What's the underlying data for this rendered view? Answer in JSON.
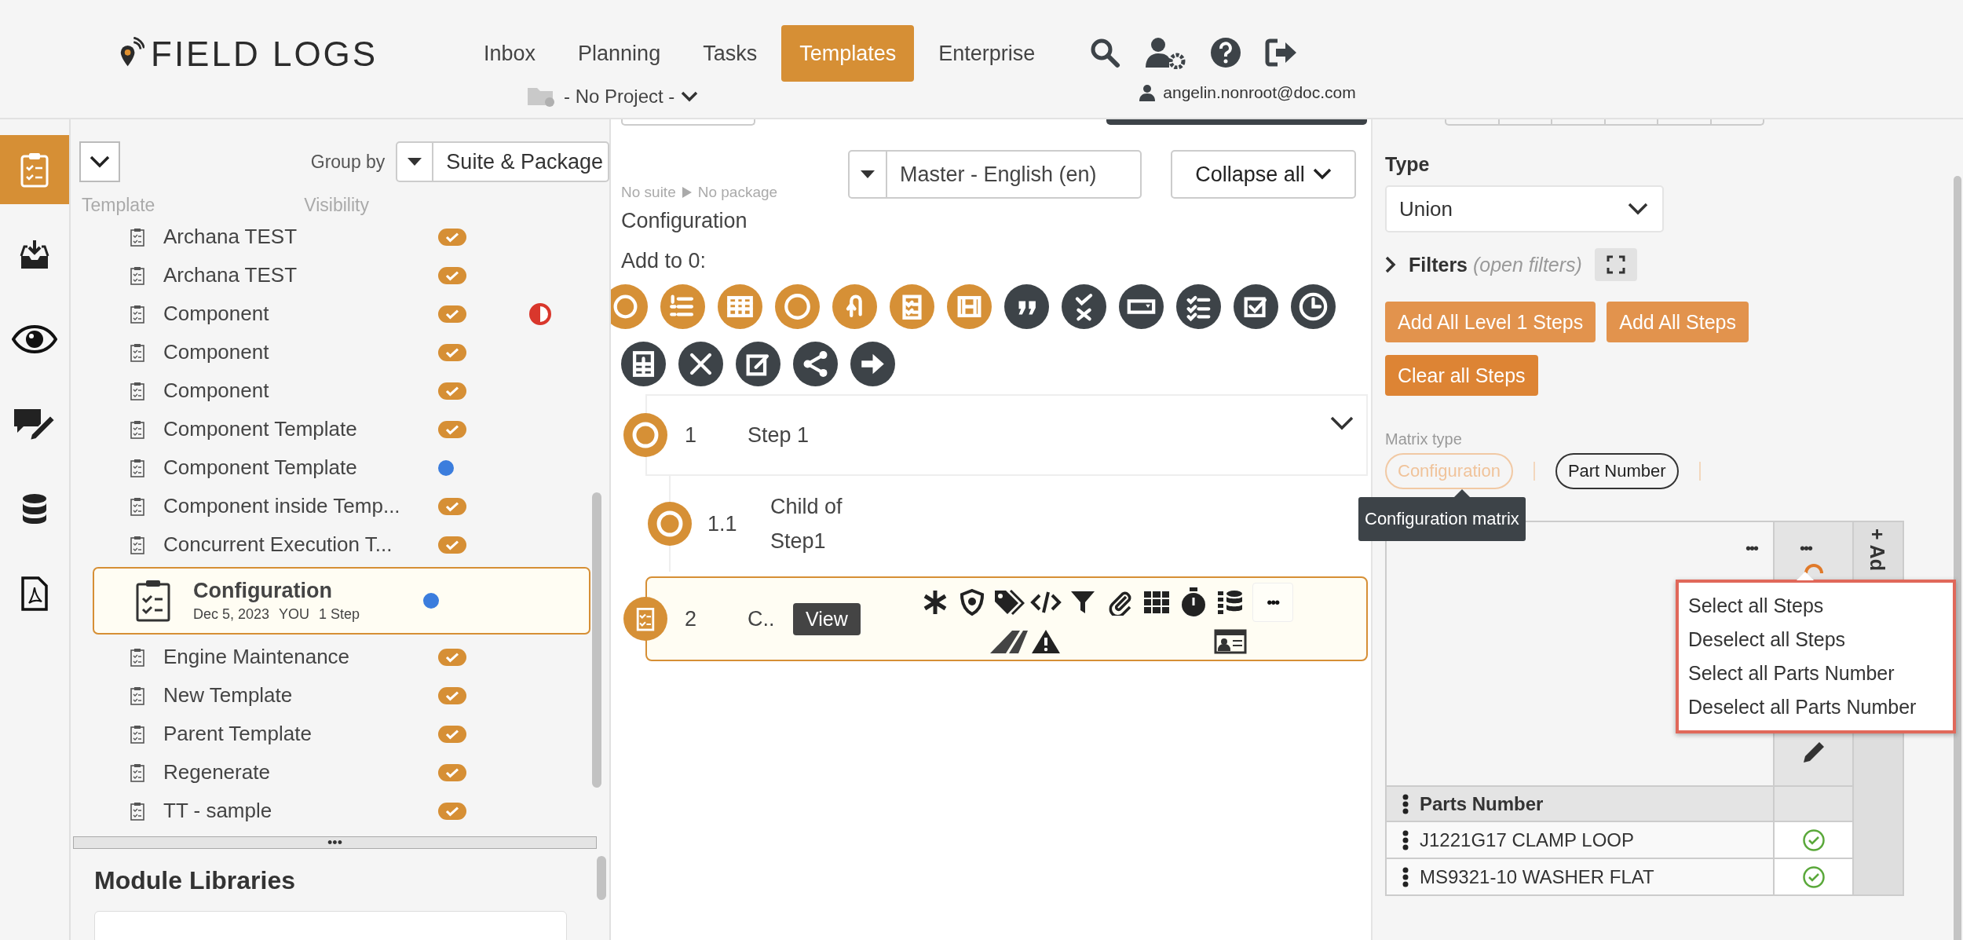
{
  "header": {
    "logo": "FIELD LOGS",
    "nav": [
      {
        "label": "Inbox",
        "selected": false
      },
      {
        "label": "Planning",
        "selected": false
      },
      {
        "label": "Tasks",
        "selected": false
      },
      {
        "label": "Templates",
        "selected": true
      },
      {
        "label": "Enterprise",
        "selected": false
      }
    ],
    "project": "- No Project -",
    "user": "angelin.nonroot@doc.com"
  },
  "rail": [
    {
      "selected": true
    },
    {
      "selected": false
    },
    {
      "selected": false
    },
    {
      "selected": false
    },
    {
      "selected": false
    },
    {
      "selected": false
    }
  ],
  "templates": {
    "group_by_label": "Group by",
    "group_by": "Suite & Package",
    "columns": [
      "Template",
      "Visibility"
    ],
    "items": [
      {
        "name": "Archana TEST",
        "visible": true,
        "flagged": false,
        "selected": false
      },
      {
        "name": "Archana TEST",
        "visible": true,
        "flagged": false,
        "selected": false
      },
      {
        "name": "Component",
        "visible": true,
        "flagged": true,
        "selected": false
      },
      {
        "name": "Component",
        "visible": true,
        "flagged": false,
        "selected": false
      },
      {
        "name": "Component",
        "visible": true,
        "flagged": false,
        "selected": false
      },
      {
        "name": "Component Template",
        "visible": true,
        "flagged": false,
        "selected": false
      },
      {
        "name": "Component Template",
        "visible": false,
        "flagged": false,
        "selected": false
      },
      {
        "name": "Component inside Temp...",
        "visible": true,
        "flagged": false,
        "selected": false
      },
      {
        "name": "Concurrent Execution T...",
        "visible": true,
        "flagged": false,
        "selected": false
      },
      {
        "name": "Configuration",
        "visible": false,
        "flagged": false,
        "selected": true,
        "date": "Dec 5, 2023",
        "author": "YOU",
        "steps": "1 Step"
      },
      {
        "name": "Engine Maintenance",
        "visible": true,
        "flagged": false,
        "selected": false
      },
      {
        "name": "New Template",
        "visible": true,
        "flagged": false,
        "selected": false
      },
      {
        "name": "Parent Template",
        "visible": true,
        "flagged": false,
        "selected": false
      },
      {
        "name": "Regenerate",
        "visible": true,
        "flagged": false,
        "selected": false
      },
      {
        "name": "TT - sample",
        "visible": true,
        "flagged": false,
        "selected": false
      }
    ],
    "more": "•••"
  },
  "module_libraries": {
    "title": "Module Libraries"
  },
  "editor": {
    "breadcrumb": [
      "No suite",
      "No package"
    ],
    "title": "Configuration",
    "language": "Master - English (en)",
    "collapse": "Collapse all",
    "add_label": "Add to 0:",
    "step_types": [
      {
        "color": "#d69036"
      },
      {
        "color": "#d69036"
      },
      {
        "color": "#d69036"
      },
      {
        "color": "#d69036"
      },
      {
        "color": "#d69036"
      },
      {
        "color": "#d69036"
      },
      {
        "color": "#d69036"
      },
      {
        "color": "#3d4348"
      },
      {
        "color": "#3d4348"
      },
      {
        "color": "#3d4348"
      },
      {
        "color": "#3d4348"
      },
      {
        "color": "#3d4348"
      },
      {
        "color": "#3d4348"
      },
      {
        "color": "#3d4348"
      },
      {
        "color": "#3d4348"
      },
      {
        "color": "#3d4348"
      },
      {
        "color": "#3d4348"
      },
      {
        "color": "#3d4348"
      }
    ],
    "steps": [
      {
        "kind": "circle",
        "number": "1",
        "title": "Step 1",
        "expanded": true,
        "selected": false,
        "children": [
          {
            "kind": "circle",
            "number": "1.1",
            "title": "Child of Step1",
            "selected": false
          }
        ]
      },
      {
        "kind": "checklist",
        "number": "2",
        "title": "C..",
        "selected": true,
        "action": "View",
        "more": "•••"
      }
    ]
  },
  "matrix": {
    "type_label": "Type",
    "type": "Union",
    "filters_label": "Filters",
    "filters_hint": "(open filters)",
    "buttons": [
      {
        "label": "Add All Level 1 Steps",
        "kind": "add"
      },
      {
        "label": "Add All Steps",
        "kind": "add"
      },
      {
        "label": "Clear all Steps",
        "kind": "clear"
      }
    ],
    "matrix_type_label": "Matrix type",
    "matrix_types": [
      {
        "label": "Configuration",
        "selected": true
      },
      {
        "label": "Part Number",
        "selected": false
      }
    ],
    "tooltip": "Configuration matrix",
    "row_more": "•••",
    "column_more": "•••",
    "add_column": "+ Ad",
    "menu": [
      "Select all Steps",
      "Deselect all Steps",
      "Select all Parts Number",
      "Deselect all Parts Number"
    ],
    "parts_header": "Parts Number",
    "parts": [
      {
        "name": "J1221G17 CLAMP LOOP",
        "checked": true
      },
      {
        "name": "MS9321-10 WASHER FLAT",
        "checked": true
      }
    ]
  }
}
